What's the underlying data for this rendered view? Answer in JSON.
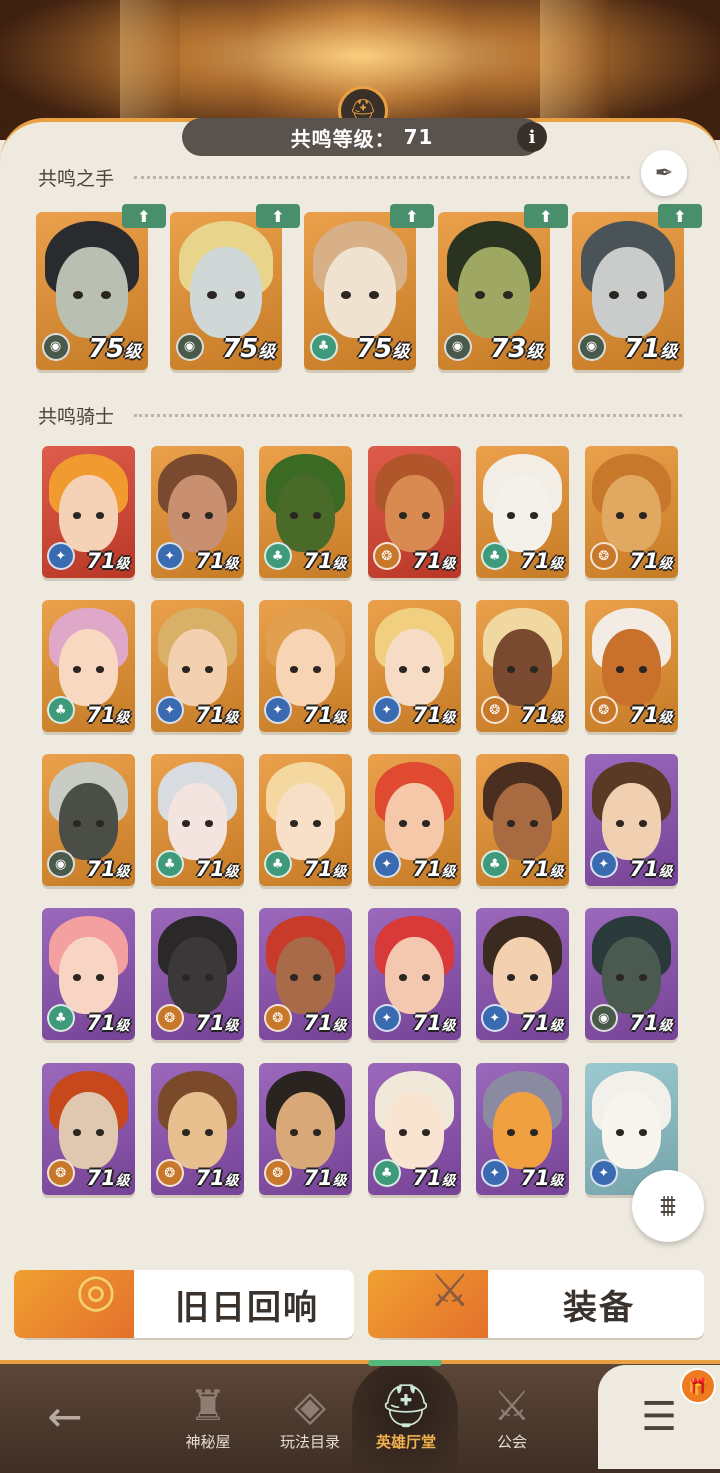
{
  "header": {
    "resonance_label": "共鸣等级：",
    "resonance_level": "71",
    "info_icon": "i",
    "emblem_icon": "helmet-icon"
  },
  "sections": {
    "hands_title": "共鸣之手",
    "knights_title": "共鸣骑士"
  },
  "level_unit": "级",
  "resonance_hands": [
    {
      "level": "75",
      "faction": "graveborn",
      "bg": "#e8902c",
      "hair": "#2a2b2f",
      "skin": "#b9c0b2",
      "upgradable": true
    },
    {
      "level": "75",
      "faction": "graveborn",
      "bg": "#e8902c",
      "hair": "#e8d48a",
      "skin": "#cfd8d6",
      "upgradable": true
    },
    {
      "level": "75",
      "faction": "wilder",
      "bg": "#e8902c",
      "hair": "#d8b088",
      "skin": "#efe2d0",
      "upgradable": true
    },
    {
      "level": "73",
      "faction": "graveborn",
      "bg": "#e8902c",
      "hair": "#2a3220",
      "skin": "#9fa862",
      "upgradable": true
    },
    {
      "level": "71",
      "faction": "graveborn",
      "bg": "#e8902c",
      "hair": "#4a5458",
      "skin": "#c9ccca",
      "upgradable": true
    }
  ],
  "resonance_knights": [
    {
      "level": "71",
      "faction": "lightbearer",
      "bg": "#d8402c",
      "hair": "#f09a30",
      "skin": "#f5d2b6"
    },
    {
      "level": "71",
      "faction": "lightbearer",
      "bg": "#e8902c",
      "hair": "#7a4a30",
      "skin": "#c89070"
    },
    {
      "level": "71",
      "faction": "wilder",
      "bg": "#e8902c",
      "hair": "#3a6a24",
      "skin": "#4a6a2a"
    },
    {
      "level": "71",
      "faction": "mauler",
      "bg": "#d8402c",
      "hair": "#b0562a",
      "skin": "#d88a50"
    },
    {
      "level": "71",
      "faction": "wilder",
      "bg": "#e8902c",
      "hair": "#f2eee6",
      "skin": "#f4f0ea"
    },
    {
      "level": "71",
      "faction": "mauler",
      "bg": "#e8902c",
      "hair": "#c8782a",
      "skin": "#e0a860"
    },
    {
      "level": "71",
      "faction": "wilder",
      "bg": "#e8902c",
      "hair": "#e0a8c8",
      "skin": "#f8d8c0"
    },
    {
      "level": "71",
      "faction": "lightbearer",
      "bg": "#e8902c",
      "hair": "#d8b068",
      "skin": "#f2d0b0"
    },
    {
      "level": "71",
      "faction": "lightbearer",
      "bg": "#e8902c",
      "hair": "#e0a050",
      "skin": "#f6d4b4"
    },
    {
      "level": "71",
      "faction": "lightbearer",
      "bg": "#e8902c",
      "hair": "#f0d080",
      "skin": "#f6dcc4"
    },
    {
      "level": "71",
      "faction": "mauler",
      "bg": "#e8902c",
      "hair": "#f0d8a0",
      "skin": "#7a4a30"
    },
    {
      "level": "71",
      "faction": "mauler",
      "bg": "#e8902c",
      "hair": "#f2ece4",
      "skin": "#c8702c"
    },
    {
      "level": "71",
      "faction": "graveborn",
      "bg": "#e8902c",
      "hair": "#c8ccc4",
      "skin": "#4a4e46"
    },
    {
      "level": "71",
      "faction": "wilder",
      "bg": "#e8902c",
      "hair": "#d8dce0",
      "skin": "#f4e4e0"
    },
    {
      "level": "71",
      "faction": "wilder",
      "bg": "#e8902c",
      "hair": "#f4d8a0",
      "skin": "#f8e0c8"
    },
    {
      "level": "71",
      "faction": "lightbearer",
      "bg": "#e8902c",
      "hair": "#e04a30",
      "skin": "#f4c8a8"
    },
    {
      "level": "71",
      "faction": "wilder",
      "bg": "#e8902c",
      "hair": "#4a2e20",
      "skin": "#a86a40"
    },
    {
      "level": "71",
      "faction": "lightbearer",
      "bg": "#8a4eb0",
      "hair": "#5a3a24",
      "skin": "#f0d0b0"
    },
    {
      "level": "71",
      "faction": "wilder",
      "bg": "#8a4eb0",
      "hair": "#f4a0a0",
      "skin": "#f8d4c4"
    },
    {
      "level": "71",
      "faction": "mauler",
      "bg": "#8a4eb0",
      "hair": "#2a2828",
      "skin": "#3a3838"
    },
    {
      "level": "71",
      "faction": "mauler",
      "bg": "#8a4eb0",
      "hair": "#c83a2a",
      "skin": "#a86a48"
    },
    {
      "level": "71",
      "faction": "lightbearer",
      "bg": "#8a4eb0",
      "hair": "#d83a3a",
      "skin": "#f4c8b0"
    },
    {
      "level": "71",
      "faction": "lightbearer",
      "bg": "#8a4eb0",
      "hair": "#3a2a20",
      "skin": "#f2d0b0"
    },
    {
      "level": "71",
      "faction": "graveborn",
      "bg": "#8a4eb0",
      "hair": "#2a3a3a",
      "skin": "#4a5a50"
    },
    {
      "level": "71",
      "faction": "mauler",
      "bg": "#8a4eb0",
      "hair": "#c8481e",
      "skin": "#e0c8b0"
    },
    {
      "level": "71",
      "faction": "mauler",
      "bg": "#8a4eb0",
      "hair": "#7a4a2a",
      "skin": "#e8c090"
    },
    {
      "level": "71",
      "faction": "mauler",
      "bg": "#8a4eb0",
      "hair": "#2a2420",
      "skin": "#d8a878"
    },
    {
      "level": "71",
      "faction": "wilder",
      "bg": "#8a4eb0",
      "hair": "#f0e8d8",
      "skin": "#f8e4d0"
    },
    {
      "level": "71",
      "faction": "lightbearer",
      "bg": "#8a4eb0",
      "hair": "#8a8aa0",
      "skin": "#f0a040"
    },
    {
      "level": "",
      "faction": "lightbearer",
      "bg": "#8ac0c8",
      "hair": "#f2f0ea",
      "skin": "#f8f4ee"
    }
  ],
  "faction_colors": {
    "graveborn": "#4a5a4a",
    "wilder": "#3e9a7a",
    "lightbearer": "#3a6ab0",
    "mauler": "#c8782a"
  },
  "faction_icons": {
    "graveborn": "◉",
    "wilder": "♣",
    "lightbearer": "✦",
    "mauler": "❂"
  },
  "buttons": {
    "echoes_label": "旧日回响",
    "echoes_icon": "ring-icon",
    "equipment_label": "装备",
    "equipment_icon": "sword-chest-icon",
    "filter_icon": "filter-icon",
    "quill_icon": "quill-icon"
  },
  "nav": {
    "back_icon": "back-arrow-icon",
    "items": [
      {
        "label": "神秘屋",
        "icon": "tower-icon"
      },
      {
        "label": "玩法目录",
        "icon": "catalog-icon"
      },
      {
        "label": "英雄厅堂",
        "icon": "helmet-icon"
      },
      {
        "label": "公会",
        "icon": "swords-icon"
      }
    ],
    "menu_icon": "menu-icon",
    "gift_icon": "gift-icon"
  }
}
